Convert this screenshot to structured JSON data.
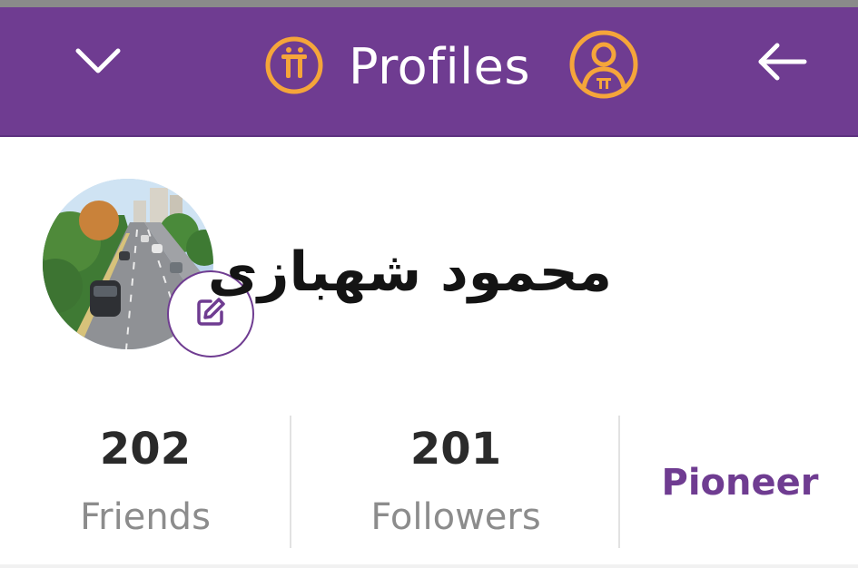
{
  "header": {
    "title": "Profiles",
    "background": "#6f3c91",
    "accent": "#f5a53a",
    "pi_logo_glyph": "π",
    "left_icon": "chevron-down-icon",
    "right_icon": "arrow-left-icon",
    "profile_icon": "pi-user-icon"
  },
  "profile": {
    "name": "محمود شهبازی",
    "avatar": "street-photo",
    "edit_icon": "edit-pencil-icon"
  },
  "stats": {
    "friends": {
      "value": "202",
      "label": "Friends"
    },
    "followers": {
      "value": "201",
      "label": "Followers"
    },
    "role": "Pioneer"
  },
  "colors": {
    "primary": "#6f3c91",
    "text_dark": "#2a2a2a",
    "text_muted": "#8c8c8c"
  }
}
